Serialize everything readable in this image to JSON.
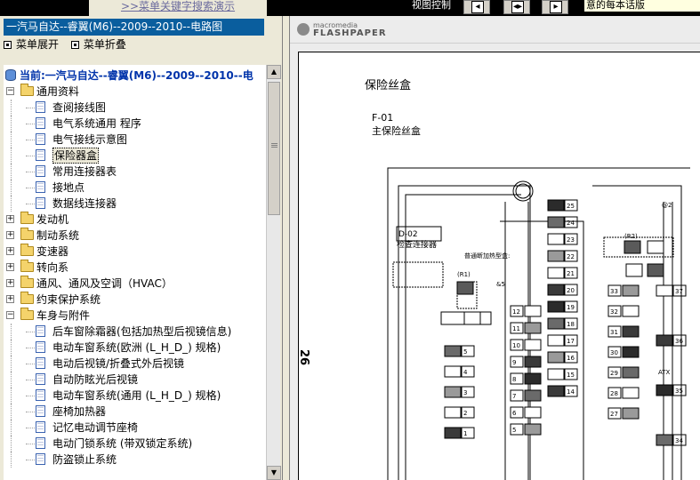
{
  "top": {
    "title": ">>菜单关键字搜索演示",
    "view_label": "视图控制",
    "notice": "意的每本话版"
  },
  "left": {
    "doc_title": "一汽马自达--睿翼(M6)--2009--2010--电路图",
    "menu": {
      "expand": "菜单展开",
      "collapse": "菜单折叠"
    },
    "current": "当前:一汽马自达--睿翼(M6)--2009--2010--电",
    "tree": [
      {
        "label": "通用资料",
        "kind": "folder",
        "expanded": true
      },
      {
        "label": "查阅接线图",
        "kind": "page"
      },
      {
        "label": "电气系统通用 程序",
        "kind": "page"
      },
      {
        "label": "电气接线示意图",
        "kind": "page"
      },
      {
        "label": "保险器盒",
        "kind": "page",
        "selected": true
      },
      {
        "label": "常用连接器表",
        "kind": "page"
      },
      {
        "label": "接地点",
        "kind": "page"
      },
      {
        "label": "数据线连接器",
        "kind": "page"
      },
      {
        "label": "发动机",
        "kind": "folder"
      },
      {
        "label": "制动系统",
        "kind": "folder"
      },
      {
        "label": "变速器",
        "kind": "folder"
      },
      {
        "label": "转向系",
        "kind": "folder"
      },
      {
        "label": "通风、通风及空调（HVAC）",
        "kind": "folder"
      },
      {
        "label": "约束保护系统",
        "kind": "folder"
      },
      {
        "label": "车身与附件",
        "kind": "folder",
        "expanded": true
      },
      {
        "label": "后车窗除霜器(包括加热型后视镜信息)",
        "kind": "page"
      },
      {
        "label": "电动车窗系统(欧洲 (L_H_D_) 规格)",
        "kind": "page"
      },
      {
        "label": "电动后视镜/折叠式外后视镜",
        "kind": "page"
      },
      {
        "label": "自动防眩光后视镜",
        "kind": "page"
      },
      {
        "label": "电动车窗系统(通用 (L_H_D_) 规格)",
        "kind": "page"
      },
      {
        "label": "座椅加热器",
        "kind": "page"
      },
      {
        "label": "记忆电动调节座椅",
        "kind": "page"
      },
      {
        "label": "电动门锁系统 (带双锁定系统)",
        "kind": "page"
      },
      {
        "label": "防盗锁止系统",
        "kind": "page"
      }
    ]
  },
  "viewer": {
    "brand_top": "macromedia",
    "brand_name": "FLASHPAPER",
    "page_title": "保险丝盒",
    "fuse_id": "F-01",
    "fuse_name": "主保险丝盒",
    "page_number": "26",
    "diagram": {
      "check_conn_id": "D-02",
      "check_conn_label": "检查连接器",
      "r1": "(R1)",
      "r2": "(R2)",
      "small_note": "普通断加热型盒:",
      "and5": "&5",
      "atx": "ATX",
      "at2": "@2",
      "col_a": [
        "25",
        "24",
        "23",
        "22",
        "21",
        "20",
        "19",
        "18",
        "17",
        "16",
        "15",
        "14"
      ],
      "col_b": [
        "12",
        "11",
        "10",
        "9",
        "8",
        "7",
        "6",
        "5"
      ],
      "col_left": [
        "5",
        "4",
        "3",
        "2",
        "1"
      ],
      "col_right": [
        "33",
        "32",
        "31",
        "30",
        "29",
        "28",
        "27"
      ],
      "col_far": [
        "37",
        "36",
        "35",
        "34"
      ]
    }
  }
}
